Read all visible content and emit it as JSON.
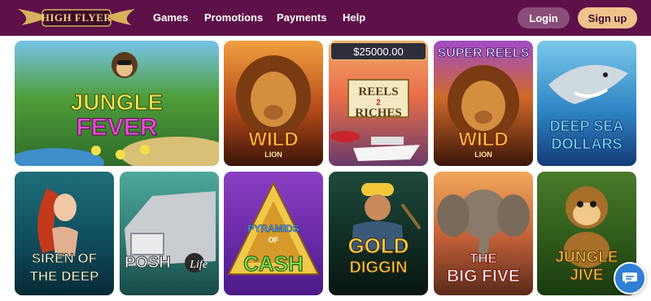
{
  "brand": {
    "logo_text": "HIGH FLYER"
  },
  "nav": {
    "items": [
      {
        "label": "Games"
      },
      {
        "label": "Promotions"
      },
      {
        "label": "Payments"
      },
      {
        "label": "Help"
      }
    ],
    "login_label": "Login",
    "signup_label": "Sign up"
  },
  "colors": {
    "header_bg": "#5e1048",
    "login_bg": "#8a4d79",
    "signup_bg": "#f1c38c"
  },
  "games": [
    {
      "title_line1": "JUNGLE",
      "title_line2": "FEVER"
    },
    {
      "title_line1": "WILD",
      "title_line2": "LION"
    },
    {
      "title_line1": "REELS",
      "title_line2": "RICHES",
      "connector": "2",
      "jackpot": "$25000.00"
    },
    {
      "banner": "SUPER REELS",
      "title_line1": "WILD",
      "title_line2": "LION"
    },
    {
      "title_line1": "DEEP SEA",
      "title_line2": "DOLLARS"
    },
    {
      "title_line1": "SIREN OF",
      "title_line2": "THE DEEP"
    },
    {
      "title_line1": "POSH",
      "title_line2": "Life"
    },
    {
      "title_line1": "PYRAMIDS",
      "title_line2": "CASH",
      "connector": "OF"
    },
    {
      "title_line1": "GOLD",
      "title_line2": "DIGGIN"
    },
    {
      "title_line1": "THE",
      "title_line2": "BIG FIVE"
    },
    {
      "title_line1": "JUNGLE",
      "title_line2": "JIVE"
    }
  ],
  "chat": {
    "icon": "chat-bubble-icon"
  }
}
